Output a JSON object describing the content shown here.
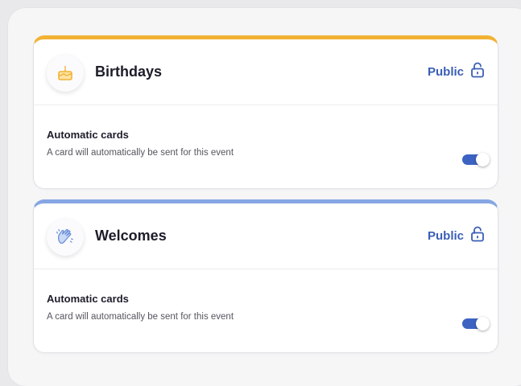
{
  "colors": {
    "birthdays_accent": "#f2b233",
    "welcomes_accent": "#86a6e3",
    "link_blue": "#3a5fb5",
    "toggle_on": "#3d63c2"
  },
  "events": [
    {
      "icon": "birthday-cake-icon",
      "title": "Birthdays",
      "visibility_label": "Public",
      "visibility_icon": "unlocked-padlock-icon",
      "automatic_title": "Automatic cards",
      "automatic_description": "A card will automatically be sent for this event",
      "automatic_enabled": true
    },
    {
      "icon": "waving-hands-icon",
      "title": "Welcomes",
      "visibility_label": "Public",
      "visibility_icon": "unlocked-padlock-icon",
      "automatic_title": "Automatic cards",
      "automatic_description": "A card will automatically be sent for this event",
      "automatic_enabled": true
    }
  ]
}
